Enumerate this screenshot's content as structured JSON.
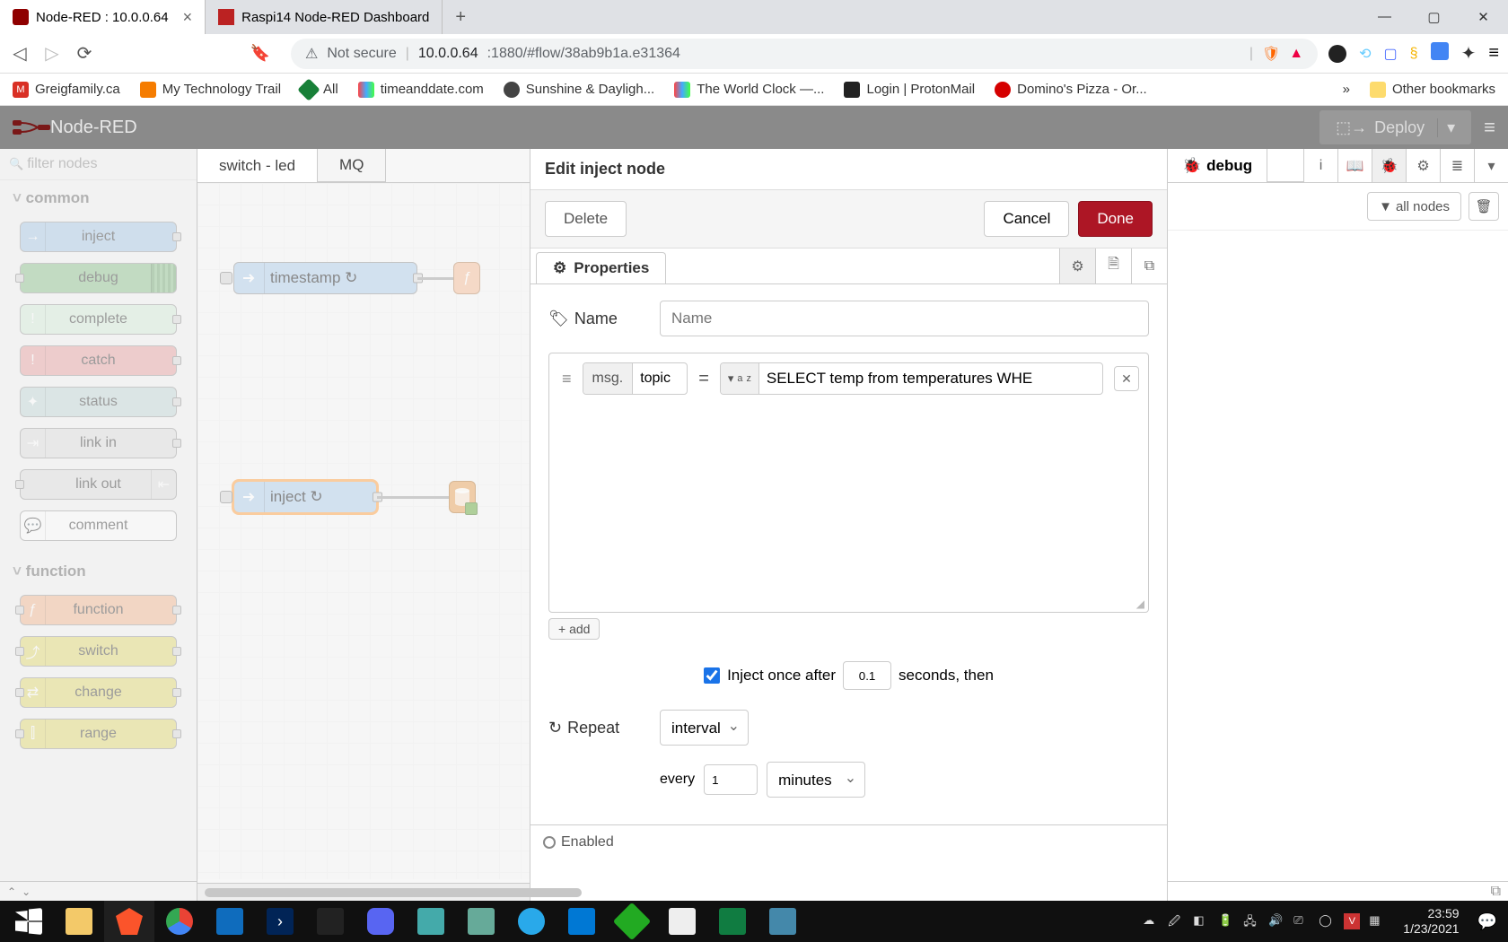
{
  "browser": {
    "tabs": [
      {
        "title": "Node-RED : 10.0.0.64",
        "active": true
      },
      {
        "title": "Raspi14 Node-RED Dashboard",
        "active": false
      }
    ],
    "address_prefix": "Not secure",
    "address_host": "10.0.0.64",
    "address_path": ":1880/#flow/38ab9b1a.e31364",
    "bookmarks": [
      {
        "label": "Greigfamily.ca",
        "color": "#d93025"
      },
      {
        "label": "My Technology Trail",
        "color": "#f57c00"
      },
      {
        "label": "All",
        "color": "#188038"
      },
      {
        "label": "timeanddate.com",
        "color": "#ffffff"
      },
      {
        "label": "Sunshine & Dayligh...",
        "color": "#444"
      },
      {
        "label": "The World Clock —...",
        "color": "#ffffff"
      },
      {
        "label": "Login | ProtonMail",
        "color": "#222"
      },
      {
        "label": "Domino's Pizza - Or...",
        "color": "#d50000"
      }
    ],
    "more": "»",
    "other_bookmarks": "Other bookmarks"
  },
  "nodered": {
    "title": "Node-RED",
    "deploy": "Deploy",
    "palette_filter": "filter nodes",
    "categories": {
      "common": {
        "label": "common",
        "nodes": [
          {
            "label": "inject",
            "bg": "#a7c7e7",
            "port_r": true,
            "icon": "→"
          },
          {
            "label": "debug",
            "bg": "#8bc28b",
            "port_l": true,
            "stripes": true
          },
          {
            "label": "complete",
            "bg": "#d4edda",
            "port_r": true,
            "icon": "!"
          },
          {
            "label": "catch",
            "bg": "#e8a0a0",
            "port_r": true,
            "icon": "!"
          },
          {
            "label": "status",
            "bg": "#c0d8d8",
            "port_r": true,
            "icon": "✦"
          },
          {
            "label": "link in",
            "bg": "#dddddd",
            "port_r": true,
            "icon": "⇥"
          },
          {
            "label": "link out",
            "bg": "#dddddd",
            "port_l": true,
            "icon_r": "⇤"
          },
          {
            "label": "comment",
            "bg": "#ffffff",
            "icon": "💬"
          }
        ]
      },
      "function": {
        "label": "function",
        "nodes": [
          {
            "label": "function",
            "bg": "#f3b78f",
            "port_l": true,
            "port_r": true,
            "icon": "ƒ"
          },
          {
            "label": "switch",
            "bg": "#e2d96e",
            "port_l": true,
            "port_r": true,
            "icon": "⤴"
          },
          {
            "label": "change",
            "bg": "#e2d96e",
            "port_l": true,
            "port_r": true,
            "icon": "⇄"
          },
          {
            "label": "range",
            "bg": "#e2d96e",
            "port_l": true,
            "port_r": true,
            "icon": "⫿"
          }
        ]
      }
    },
    "workspace_tabs": [
      "switch - led",
      "MQ"
    ],
    "flow_nodes": {
      "timestamp": "timestamp ↻",
      "inject": "inject ↻"
    }
  },
  "tray": {
    "title": "Edit inject node",
    "delete": "Delete",
    "cancel": "Cancel",
    "done": "Done",
    "properties_tab": "Properties",
    "name_label": "Name",
    "name_placeholder": "Name",
    "msg_prefix": "msg.",
    "msg_key": "topic",
    "msg_value": "SELECT temp from temperatures WHE",
    "add": "+ add",
    "inject_once": "Inject once after",
    "inject_once_val": "0.1",
    "inject_once_suffix": "seconds, then",
    "repeat_label": "Repeat",
    "repeat_mode": "interval",
    "every_label": "every",
    "every_val": "1",
    "every_unit": "minutes",
    "enabled": "Enabled"
  },
  "sidebar": {
    "tab": "debug",
    "all_nodes": "all nodes"
  },
  "taskbar": {
    "time": "23:59",
    "date": "1/23/2021"
  }
}
